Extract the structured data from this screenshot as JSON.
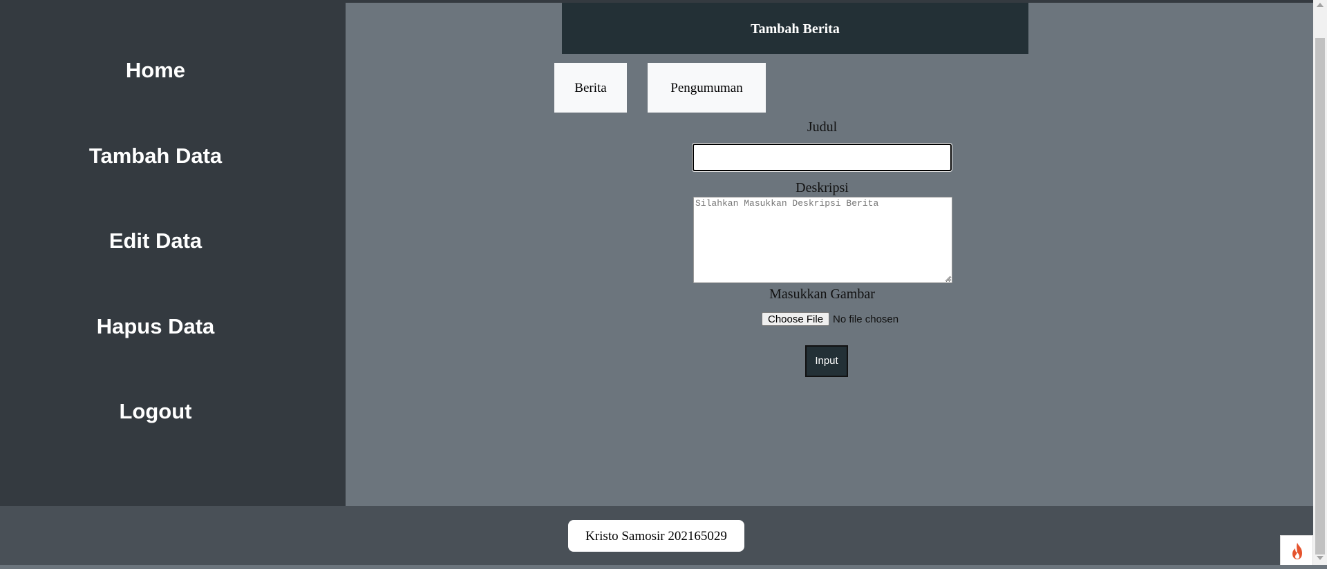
{
  "sidebar": {
    "items": [
      {
        "label": "Home"
      },
      {
        "label": "Tambah Data"
      },
      {
        "label": "Edit Data"
      },
      {
        "label": "Hapus Data"
      },
      {
        "label": "Logout"
      }
    ]
  },
  "header": {
    "title": "Tambah Berita"
  },
  "tabs": [
    {
      "label": "Berita"
    },
    {
      "label": "Pengumuman"
    }
  ],
  "form": {
    "title_label": "Judul",
    "title_value": "",
    "description_label": "Deskripsi",
    "description_placeholder": "Silahkan Masukkan Deskripsi Berita",
    "image_label": "Masukkan Gambar",
    "file_button_label": "Choose File",
    "file_status": "No file chosen",
    "submit_label": "Input"
  },
  "footer": {
    "text": "Kristo Samosir 202165029"
  },
  "widget": {
    "icon": "flame-icon"
  },
  "colors": {
    "sidebar": "#343a40",
    "main": "#6c757d",
    "header": "#233036",
    "footer": "#495057",
    "flame": "#e5532d"
  }
}
